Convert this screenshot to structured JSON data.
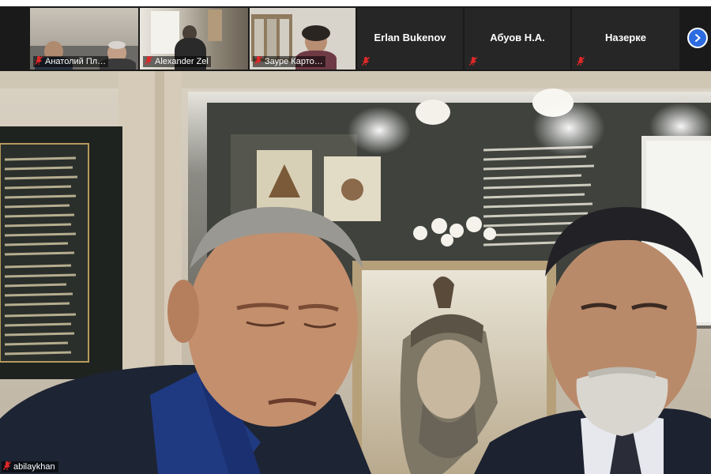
{
  "participants": [
    {
      "name": "Анатолий Пл…",
      "muted": true,
      "video": true
    },
    {
      "name": "Alexander Zel",
      "muted": true,
      "video": true
    },
    {
      "name": "Зауре Карто…",
      "muted": true,
      "video": true
    },
    {
      "name": "Erlan Bukenov",
      "muted": true,
      "video": false
    },
    {
      "name": "Абуов Н.А.",
      "muted": true,
      "video": false
    },
    {
      "name": "Назерке",
      "muted": true,
      "video": false
    }
  ],
  "active_speaker": {
    "name": "abilaykhan",
    "muted": true
  },
  "icons": {
    "mute": "mic-muted-icon",
    "next": "chevron-right-icon"
  },
  "colors": {
    "strip_bg": "#1a1a1a",
    "tile_bg": "#262626",
    "mute_red": "#e02828",
    "accent_blue": "#2d6be0"
  }
}
